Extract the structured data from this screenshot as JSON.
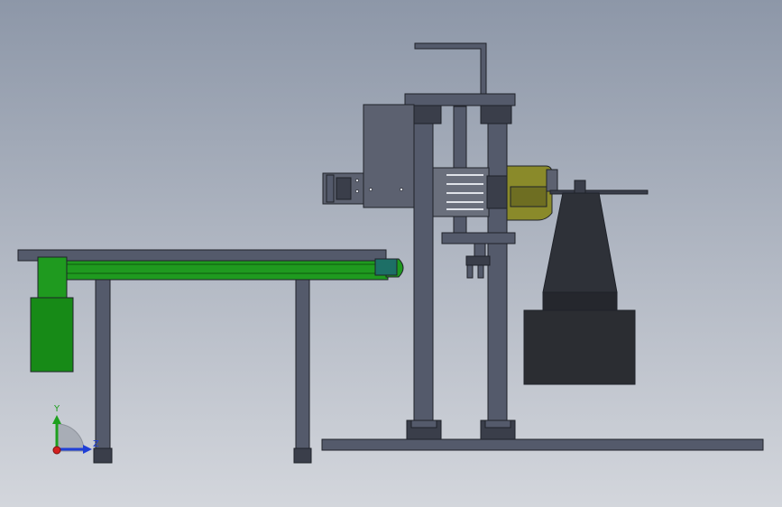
{
  "viewport": {
    "background_top": "#8d97a8",
    "background_bottom": "#d3d6dc"
  },
  "colors": {
    "frame_steel": "#545a6b",
    "frame_dark": "#3a3e4a",
    "plate": "#5c6170",
    "conveyor_green": "#1f9a1f",
    "motor_green": "#178a17",
    "teal_endcap": "#1d6f66",
    "gearbox_olive": "#8a8a2a",
    "hopper_dark": "#2e3138",
    "base_block": "#2b2d32",
    "x_axis": "#d42020",
    "y_axis": "#1ea01e",
    "z_axis": "#1f3fd6"
  },
  "triad": {
    "y_label": "Y",
    "z_label": "Z"
  }
}
